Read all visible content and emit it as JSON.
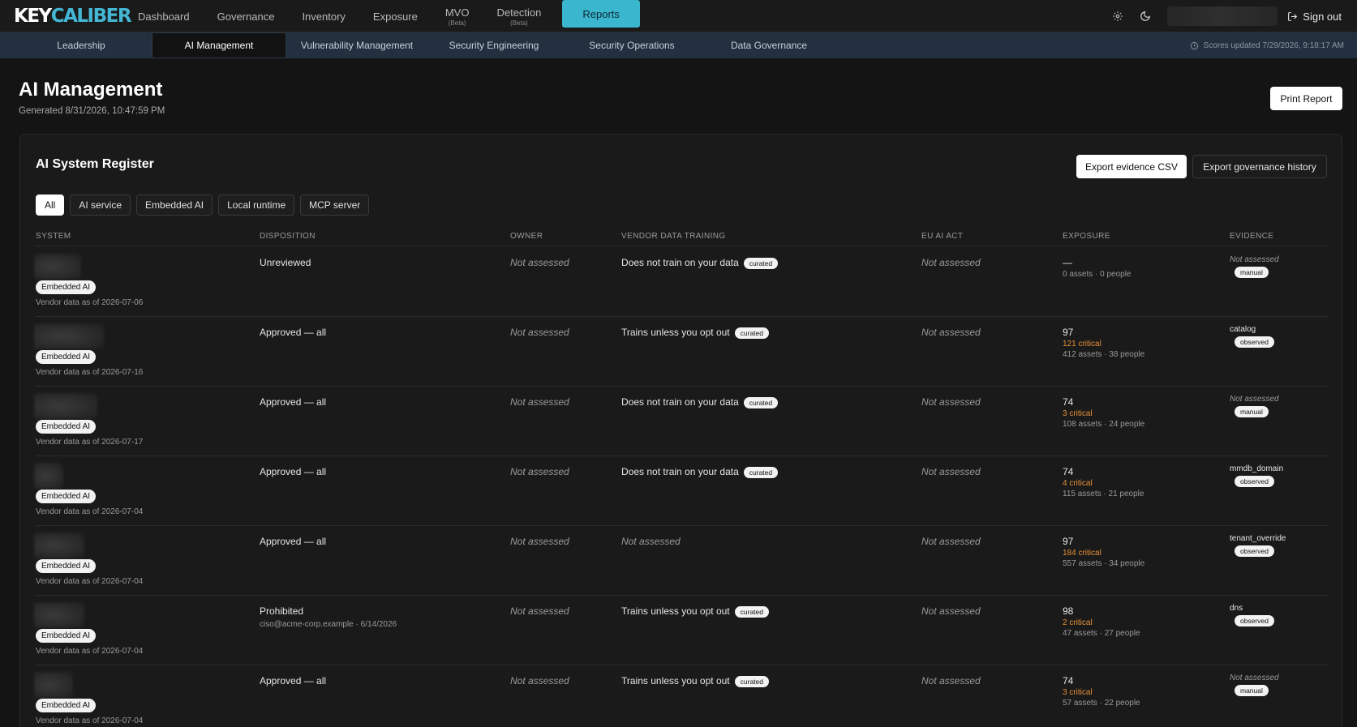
{
  "brand": {
    "logo_left": "KEY",
    "logo_right": "CALIBER",
    "accent": "#3ab6cf"
  },
  "topnav": {
    "items": [
      {
        "label": "Dashboard",
        "sub": ""
      },
      {
        "label": "Governance",
        "sub": ""
      },
      {
        "label": "Inventory",
        "sub": ""
      },
      {
        "label": "Exposure",
        "sub": ""
      },
      {
        "label": "MVO",
        "sub": "(Beta)"
      },
      {
        "label": "Detection",
        "sub": "(Beta)"
      },
      {
        "label": "Reports",
        "sub": ""
      }
    ],
    "active": "Reports",
    "settings_icon": "gear-icon",
    "theme_icon": "moon-icon",
    "signout_label": "Sign out",
    "signout_icon": "sign-out-icon"
  },
  "subnav": {
    "tabs": [
      "Leadership",
      "AI Management",
      "Vulnerability Management",
      "Security Engineering",
      "Security Operations",
      "Data Governance"
    ],
    "active": "AI Management",
    "scores_updated": "Scores updated 7/29/2026, 9:18:17 AM",
    "clock_icon": "clock-icon"
  },
  "page": {
    "title": "AI Management",
    "generated": "Generated 8/31/2026, 10:47:59 PM",
    "print_label": "Print Report"
  },
  "register": {
    "title": "AI System Register",
    "export_csv_label": "Export evidence CSV",
    "export_history_label": "Export governance history",
    "filters": [
      "All",
      "AI service",
      "Embedded AI",
      "Local runtime",
      "MCP server"
    ],
    "active_filter": "All",
    "columns": [
      "SYSTEM",
      "DISPOSITION",
      "OWNER",
      "VENDOR DATA TRAINING",
      "EU AI ACT",
      "EXPOSURE",
      "EVIDENCE"
    ],
    "rows": [
      {
        "type": "Embedded AI",
        "vendor_date": "Vendor data as of 2026-07-06",
        "disposition": "Unreviewed",
        "disposition_note": "",
        "owner": "Not assessed",
        "training": "Does not train on your data",
        "training_tag": "curated",
        "eu_act": "Not assessed",
        "score": "—",
        "critical": "",
        "assets": "0 assets · 0 people",
        "evidence": "Not assessed",
        "evidence_tag": "manual"
      },
      {
        "type": "Embedded AI",
        "vendor_date": "Vendor data as of 2026-07-16",
        "disposition": "Approved — all",
        "disposition_note": "",
        "owner": "Not assessed",
        "training": "Trains unless you opt out",
        "training_tag": "curated",
        "eu_act": "Not assessed",
        "score": "97",
        "critical": "121 critical",
        "assets": "412 assets · 38 people",
        "evidence": "catalog",
        "evidence_tag": "observed"
      },
      {
        "type": "Embedded AI",
        "vendor_date": "Vendor data as of 2026-07-17",
        "disposition": "Approved — all",
        "disposition_note": "",
        "owner": "Not assessed",
        "training": "Does not train on your data",
        "training_tag": "curated",
        "eu_act": "Not assessed",
        "score": "74",
        "critical": "3 critical",
        "assets": "108 assets · 24 people",
        "evidence": "Not assessed",
        "evidence_tag": "manual"
      },
      {
        "type": "Embedded AI",
        "vendor_date": "Vendor data as of 2026-07-04",
        "disposition": "Approved — all",
        "disposition_note": "",
        "owner": "Not assessed",
        "training": "Does not train on your data",
        "training_tag": "curated",
        "eu_act": "Not assessed",
        "score": "74",
        "critical": "4 critical",
        "assets": "115 assets · 21 people",
        "evidence": "mmdb_domain",
        "evidence_tag": "observed"
      },
      {
        "type": "Embedded AI",
        "vendor_date": "Vendor data as of 2026-07-04",
        "disposition": "Approved — all",
        "disposition_note": "",
        "owner": "Not assessed",
        "training": "Not assessed",
        "training_tag": "",
        "eu_act": "Not assessed",
        "score": "97",
        "critical": "184 critical",
        "assets": "557 assets · 34 people",
        "evidence": "tenant_override",
        "evidence_tag": "observed"
      },
      {
        "type": "Embedded AI",
        "vendor_date": "Vendor data as of 2026-07-04",
        "disposition": "Prohibited",
        "disposition_note": "ciso@acme-corp.example · 6/14/2026",
        "owner": "Not assessed",
        "training": "Trains unless you opt out",
        "training_tag": "curated",
        "eu_act": "Not assessed",
        "score": "98",
        "critical": "2 critical",
        "assets": "47 assets · 27 people",
        "evidence": "dns",
        "evidence_tag": "observed"
      },
      {
        "type": "Embedded AI",
        "vendor_date": "Vendor data as of 2026-07-04",
        "disposition": "Approved — all",
        "disposition_note": "",
        "owner": "Not assessed",
        "training": "Trains unless you opt out",
        "training_tag": "curated",
        "eu_act": "Not assessed",
        "score": "74",
        "critical": "3 critical",
        "assets": "57 assets · 22 people",
        "evidence": "Not assessed",
        "evidence_tag": "manual"
      }
    ]
  }
}
